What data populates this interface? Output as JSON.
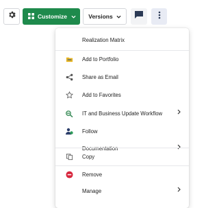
{
  "toolbar": {
    "customize_label": "Customize",
    "versions_label": "Versions",
    "icons": {
      "settings": "gear-icon",
      "customize": "grid-icon",
      "comments": "comment-icon",
      "more": "kebab-icon"
    }
  },
  "menu": {
    "items": [
      {
        "label": "Realization Matrix",
        "icon": null
      },
      {
        "label": "Add to Portfolio",
        "icon": "folder-icon"
      },
      {
        "label": "Share as Email",
        "icon": "share-icon"
      },
      {
        "label": "Add to Favorites",
        "icon": "star-icon"
      },
      {
        "label": "IT and Business Update Workflow",
        "icon": "workflow-icon",
        "submenu": true
      },
      {
        "label": "Follow",
        "icon": "follow-icon"
      },
      {
        "label": "Documentation",
        "icon": null,
        "submenu": true
      },
      {
        "label": "Copy",
        "icon": "copy-icon"
      },
      {
        "label": "Remove",
        "icon": "remove-icon"
      },
      {
        "label": "Manage",
        "icon": null,
        "submenu": true
      }
    ]
  },
  "colors": {
    "primary": "#1e8a4c",
    "remove": "#d7263d",
    "folder": "#e6b422",
    "workflow": "#3c8d5a"
  }
}
